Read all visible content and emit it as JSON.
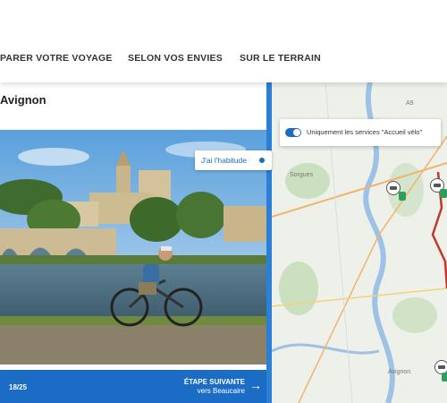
{
  "nav": {
    "items": [
      "PARER VOTRE VOYAGE",
      "SELON VOS ENVIES",
      "SUR LE TERRAIN"
    ]
  },
  "stage": {
    "title": "Avignon",
    "badge_label": "J'ai l'habitude",
    "counter": "18/25",
    "next_label": "ÉTAPE SUIVANTE",
    "next_destination": "vers Beaucaire",
    "next_arrow": "→"
  },
  "map": {
    "filter_label": "Uniquement les services \"Accueil vélo\"",
    "filter_enabled": true,
    "place_labels": [
      "Avignon",
      "Sorgues",
      "A9"
    ],
    "route_color": "#c0392b"
  },
  "colors": {
    "accent": "#1b6cc4",
    "badge_green": "#2e9e5b"
  }
}
